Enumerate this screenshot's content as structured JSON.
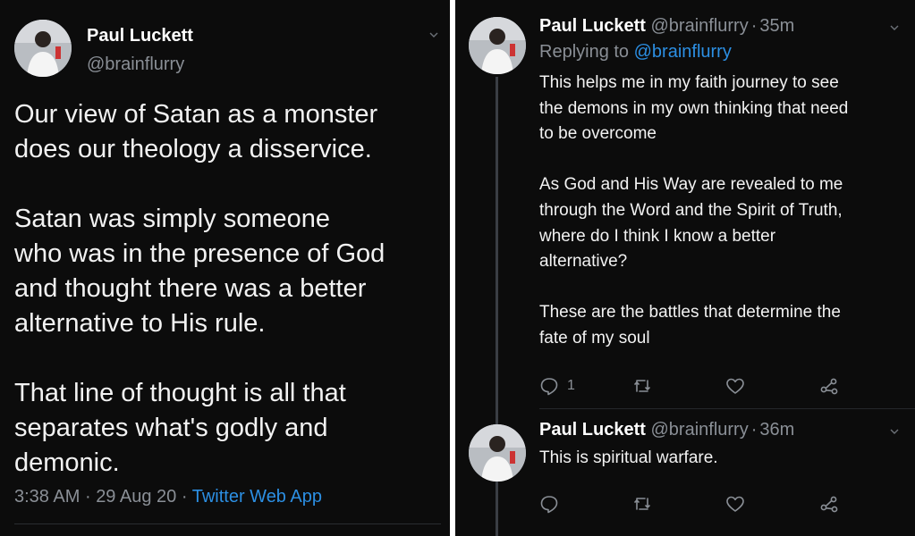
{
  "main_tweet": {
    "display_name": "Paul Luckett",
    "handle": "@brainflurry",
    "text": "Our view of Satan as a monster\ndoes our theology a disservice.\n\nSatan was simply someone\nwho was in the presence of God\nand thought there was a better\nalternative to His rule.\n\nThat line of thought is all that\nseparates what's godly and\ndemonic.",
    "time": "3:38 AM",
    "date": "29 Aug 20",
    "separator": "·",
    "source": "Twitter Web App"
  },
  "replies": [
    {
      "display_name": "Paul Luckett",
      "handle": "@brainflurry",
      "age": "35m",
      "separator": "·",
      "replying_prefix": "Replying to",
      "replying_to": "@brainflurry",
      "text": "This helps me in my faith journey to see\nthe demons in my own thinking that need\nto be overcome\n\nAs God and His Way are revealed to me\nthrough the Word and the Spirit of Truth,\nwhere do I think I know a better\nalternative?\n\nThese are the battles that determine the\nfate of my soul",
      "reply_count": "1"
    },
    {
      "display_name": "Paul Luckett",
      "handle": "@brainflurry",
      "age": "36m",
      "separator": "·",
      "text": "This is spiritual warfare.",
      "reply_count": ""
    }
  ],
  "icons": {
    "reply": "reply-icon",
    "retweet": "retweet-icon",
    "like": "like-icon",
    "share": "share-icon",
    "chevron": "chevron-down-icon"
  },
  "colors": {
    "background": "#0c0c0c",
    "text": "#ffffff",
    "muted": "#8a8f96",
    "link": "#2c8fe3"
  }
}
